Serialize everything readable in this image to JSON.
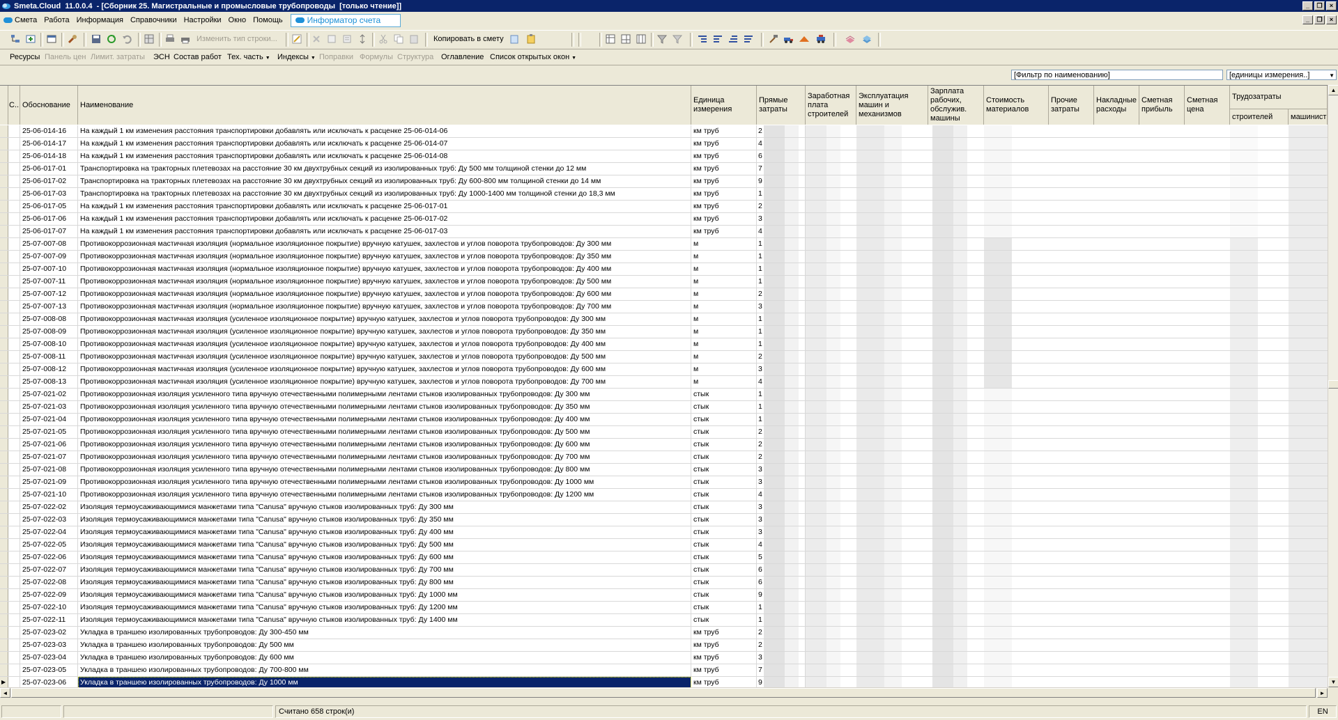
{
  "window": {
    "app_name": "Smeta.Cloud",
    "version": "11.0.0.4",
    "document_title": "- [Сборник 25. Магистральные и промысловые трубопроводы  [только чтение]]"
  },
  "menu": {
    "items": [
      "Смета",
      "Работа",
      "Информация",
      "Справочники",
      "Настройки",
      "Окно",
      "Помощь"
    ],
    "informer_tab": "Информатор счета"
  },
  "toolbar": {
    "change_row_type": "Изменить тип строки...",
    "copy_to_estimate": "Копировать в смету"
  },
  "toolbar2": {
    "items": [
      {
        "label": "Ресурсы",
        "enabled": true,
        "dropdown": false
      },
      {
        "label": "Панель цен",
        "enabled": false,
        "dropdown": false
      },
      {
        "label": "Лимит. затраты",
        "enabled": false,
        "dropdown": false
      },
      {
        "label": "ЭСН",
        "enabled": true,
        "dropdown": false
      },
      {
        "label": "Состав работ",
        "enabled": true,
        "dropdown": false
      },
      {
        "label": "Тех. часть",
        "enabled": true,
        "dropdown": true
      },
      {
        "label": "Индексы",
        "enabled": true,
        "dropdown": true
      },
      {
        "label": "Поправки",
        "enabled": false,
        "dropdown": false
      },
      {
        "label": "Формулы",
        "enabled": false,
        "dropdown": false
      },
      {
        "label": "Структура",
        "enabled": false,
        "dropdown": false
      },
      {
        "label": "Оглавление",
        "enabled": true,
        "dropdown": false
      },
      {
        "label": "Список открытых окон",
        "enabled": true,
        "dropdown": true
      }
    ]
  },
  "filters": {
    "name_filter": "[Фильтр по наименованию]",
    "unit_filter": "[единицы измерения..]"
  },
  "grid": {
    "columns": {
      "c": "С..",
      "code": "Обоснование",
      "name": "Наименование",
      "unit": "Единица измерения",
      "direct": "Прямые затраты",
      "wage": "Заработная плата строителей",
      "machines": "Эксплуатация машин и механизмов",
      "machinist_wage": "Зарплата рабочих, обслужив. машины",
      "materials": "Стоимость материалов",
      "other": "Прочие затраты",
      "overhead": "Накладные расходы",
      "profit": "Сметная прибыль",
      "price": "Сметная цена",
      "labor": "Трудозатраты",
      "labor_builders": "строителей",
      "labor_machinists": "машинист"
    },
    "rows": [
      {
        "code": "25-06-014-16",
        "name": "На каждый 1 км изменения расстояния транспортировки добавлять или исключать к расценке 25-06-014-06",
        "unit": "км труб",
        "direct": "2"
      },
      {
        "code": "25-06-014-17",
        "name": "На каждый 1 км изменения расстояния транспортировки добавлять или исключать к расценке 25-06-014-07",
        "unit": "км труб",
        "direct": "4"
      },
      {
        "code": "25-06-014-18",
        "name": "На каждый 1 км изменения расстояния транспортировки добавлять или исключать к расценке 25-06-014-08",
        "unit": "км труб",
        "direct": "6"
      },
      {
        "code": "25-06-017-01",
        "name": "Транспортировка на тракторных плетевозах на расстояние 30 км двухтрубных секций из изолированных труб: Ду 500 мм толщиной стенки до 12 мм",
        "unit": "км труб",
        "direct": "7"
      },
      {
        "code": "25-06-017-02",
        "name": "Транспортировка на тракторных плетевозах на расстояние 30 км двухтрубных секций из изолированных труб: Ду 600-800 мм толщиной стенки до 14 мм",
        "unit": "км труб",
        "direct": "9"
      },
      {
        "code": "25-06-017-03",
        "name": "Транспортировка на тракторных плетевозах на расстояние 30 км двухтрубных секций из изолированных труб: Ду 1000-1400 мм толщиной стенки до 18,3 мм",
        "unit": "км труб",
        "direct": "1"
      },
      {
        "code": "25-06-017-05",
        "name": "На каждый 1 км изменения расстояния транспортировки добавлять или исключать к расценке 25-06-017-01",
        "unit": "км труб",
        "direct": "2"
      },
      {
        "code": "25-06-017-06",
        "name": "На каждый 1 км изменения расстояния транспортировки добавлять или исключать к расценке 25-06-017-02",
        "unit": "км труб",
        "direct": "3"
      },
      {
        "code": "25-06-017-07",
        "name": "На каждый 1 км изменения расстояния транспортировки добавлять или исключать к расценке 25-06-017-03",
        "unit": "км труб",
        "direct": "4"
      },
      {
        "code": "25-07-007-08",
        "name": "Противокоррозионная мастичная изоляция (нормальное изоляционное покрытие) вручную катушек, захлестов и углов поворота трубопроводов: Ду 300 мм",
        "unit": "м",
        "direct": "1"
      },
      {
        "code": "25-07-007-09",
        "name": "Противокоррозионная мастичная изоляция (нормальное изоляционное покрытие) вручную катушек, захлестов и углов поворота трубопроводов: Ду 350 мм",
        "unit": "м",
        "direct": "1"
      },
      {
        "code": "25-07-007-10",
        "name": "Противокоррозионная мастичная изоляция (нормальное изоляционное покрытие) вручную катушек, захлестов и углов поворота трубопроводов: Ду 400 мм",
        "unit": "м",
        "direct": "1"
      },
      {
        "code": "25-07-007-11",
        "name": "Противокоррозионная мастичная изоляция (нормальное изоляционное покрытие) вручную катушек, захлестов и углов поворота трубопроводов: Ду 500 мм",
        "unit": "м",
        "direct": "1"
      },
      {
        "code": "25-07-007-12",
        "name": "Противокоррозионная мастичная изоляция (нормальное изоляционное покрытие) вручную катушек, захлестов и углов поворота трубопроводов: Ду 600 мм",
        "unit": "м",
        "direct": "2"
      },
      {
        "code": "25-07-007-13",
        "name": "Противокоррозионная мастичная изоляция (нормальное изоляционное покрытие) вручную катушек, захлестов и углов поворота трубопроводов: Ду 700 мм",
        "unit": "м",
        "direct": "3"
      },
      {
        "code": "25-07-008-08",
        "name": "Противокоррозионная мастичная изоляция (усиленное изоляционное покрытие) вручную катушек, захлестов и углов поворота трубопроводов: Ду 300 мм",
        "unit": "м",
        "direct": "1"
      },
      {
        "code": "25-07-008-09",
        "name": "Противокоррозионная мастичная изоляция (усиленное изоляционное покрытие) вручную катушек, захлестов и углов поворота трубопроводов: Ду 350 мм",
        "unit": "м",
        "direct": "1"
      },
      {
        "code": "25-07-008-10",
        "name": "Противокоррозионная мастичная изоляция (усиленное изоляционное покрытие) вручную катушек, захлестов и углов поворота трубопроводов: Ду 400 мм",
        "unit": "м",
        "direct": "1"
      },
      {
        "code": "25-07-008-11",
        "name": "Противокоррозионная мастичная изоляция (усиленное изоляционное покрытие) вручную катушек, захлестов и углов поворота трубопроводов: Ду 500 мм",
        "unit": "м",
        "direct": "2"
      },
      {
        "code": "25-07-008-12",
        "name": "Противокоррозионная мастичная изоляция (усиленное изоляционное покрытие) вручную катушек, захлестов и углов поворота трубопроводов: Ду 600 мм",
        "unit": "м",
        "direct": "3"
      },
      {
        "code": "25-07-008-13",
        "name": "Противокоррозионная мастичная изоляция (усиленное изоляционное покрытие) вручную катушек, захлестов и углов поворота трубопроводов: Ду 700 мм",
        "unit": "м",
        "direct": "4"
      },
      {
        "code": "25-07-021-02",
        "name": "Противокоррозионная изоляция усиленного типа вручную отечественными полимерными лентами стыков изолированных трубопроводов: Ду 300 мм",
        "unit": "стык",
        "direct": "1"
      },
      {
        "code": "25-07-021-03",
        "name": "Противокоррозионная изоляция усиленного типа вручную отечественными полимерными лентами стыков изолированных трубопроводов: Ду 350 мм",
        "unit": "стык",
        "direct": "1"
      },
      {
        "code": "25-07-021-04",
        "name": "Противокоррозионная изоляция усиленного типа вручную отечественными полимерными лентами стыков изолированных трубопроводов: Ду 400 мм",
        "unit": "стык",
        "direct": "1"
      },
      {
        "code": "25-07-021-05",
        "name": "Противокоррозионная изоляция усиленного типа вручную отечественными полимерными лентами стыков изолированных трубопроводов: Ду 500 мм",
        "unit": "стык",
        "direct": "2"
      },
      {
        "code": "25-07-021-06",
        "name": "Противокоррозионная изоляция усиленного типа вручную отечественными полимерными лентами стыков изолированных трубопроводов: Ду 600 мм",
        "unit": "стык",
        "direct": "2"
      },
      {
        "code": "25-07-021-07",
        "name": "Противокоррозионная изоляция усиленного типа вручную отечественными полимерными лентами стыков изолированных трубопроводов: Ду 700 мм",
        "unit": "стык",
        "direct": "2"
      },
      {
        "code": "25-07-021-08",
        "name": "Противокоррозионная изоляция усиленного типа вручную отечественными полимерными лентами стыков изолированных трубопроводов: Ду 800 мм",
        "unit": "стык",
        "direct": "3"
      },
      {
        "code": "25-07-021-09",
        "name": "Противокоррозионная изоляция усиленного типа вручную отечественными полимерными лентами стыков изолированных трубопроводов: Ду 1000 мм",
        "unit": "стык",
        "direct": "3"
      },
      {
        "code": "25-07-021-10",
        "name": "Противокоррозионная изоляция усиленного типа вручную отечественными полимерными лентами стыков изолированных трубопроводов: Ду 1200 мм",
        "unit": "стык",
        "direct": "4"
      },
      {
        "code": "25-07-022-02",
        "name": "Изоляция термоусаживающимися манжетами типа \"Canusa\" вручную стыков изолированных труб: Ду 300 мм",
        "unit": "стык",
        "direct": "3"
      },
      {
        "code": "25-07-022-03",
        "name": "Изоляция термоусаживающимися манжетами типа \"Canusa\" вручную стыков изолированных труб: Ду 350 мм",
        "unit": "стык",
        "direct": "3"
      },
      {
        "code": "25-07-022-04",
        "name": "Изоляция термоусаживающимися манжетами типа \"Canusa\" вручную стыков изолированных труб: Ду 400 мм",
        "unit": "стык",
        "direct": "3"
      },
      {
        "code": "25-07-022-05",
        "name": "Изоляция термоусаживающимися манжетами типа \"Canusa\" вручную стыков изолированных труб: Ду 500 мм",
        "unit": "стык",
        "direct": "4"
      },
      {
        "code": "25-07-022-06",
        "name": "Изоляция термоусаживающимися манжетами типа \"Canusa\" вручную стыков изолированных труб: Ду 600 мм",
        "unit": "стык",
        "direct": "5"
      },
      {
        "code": "25-07-022-07",
        "name": "Изоляция термоусаживающимися манжетами типа \"Canusa\" вручную стыков изолированных труб: Ду 700 мм",
        "unit": "стык",
        "direct": "6"
      },
      {
        "code": "25-07-022-08",
        "name": "Изоляция термоусаживающимися манжетами типа \"Canusa\" вручную стыков изолированных труб: Ду 800 мм",
        "unit": "стык",
        "direct": "6"
      },
      {
        "code": "25-07-022-09",
        "name": "Изоляция термоусаживающимися манжетами типа \"Canusa\" вручную стыков изолированных труб: Ду 1000 мм",
        "unit": "стык",
        "direct": "9"
      },
      {
        "code": "25-07-022-10",
        "name": "Изоляция термоусаживающимися манжетами типа \"Canusa\" вручную стыков изолированных труб: Ду 1200 мм",
        "unit": "стык",
        "direct": "1"
      },
      {
        "code": "25-07-022-11",
        "name": "Изоляция термоусаживающимися манжетами типа \"Canusa\" вручную стыков изолированных труб: Ду 1400 мм",
        "unit": "стык",
        "direct": "1"
      },
      {
        "code": "25-07-023-02",
        "name": "Укладка в траншею изолированных трубопроводов: Ду 300-450 мм",
        "unit": "км труб",
        "direct": "2"
      },
      {
        "code": "25-07-023-03",
        "name": "Укладка в траншею изолированных трубопроводов: Ду 500 мм",
        "unit": "км труб",
        "direct": "2"
      },
      {
        "code": "25-07-023-04",
        "name": "Укладка в траншею изолированных трубопроводов: Ду 600 мм",
        "unit": "км труб",
        "direct": "3"
      },
      {
        "code": "25-07-023-05",
        "name": "Укладка в траншею изолированных трубопроводов: Ду 700-800 мм",
        "unit": "км труб",
        "direct": "7"
      },
      {
        "code": "25-07-023-06",
        "name": "Укладка в траншею изолированных трубопроводов: Ду 1000 мм",
        "unit": "км труб",
        "direct": "9",
        "selected": true
      }
    ]
  },
  "status": {
    "rows_count": "Считано 658 строк(и)",
    "lang": "EN"
  }
}
